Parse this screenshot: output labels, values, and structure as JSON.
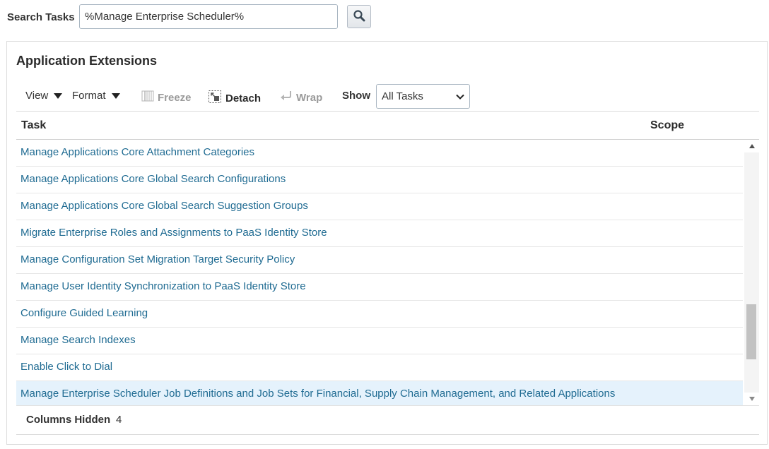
{
  "search": {
    "label": "Search Tasks",
    "value": "%Manage Enterprise Scheduler%",
    "button_icon": "search-icon"
  },
  "panel": {
    "title": "Application Extensions"
  },
  "toolbar": {
    "view_label": "View",
    "format_label": "Format",
    "freeze_label": "Freeze",
    "detach_label": "Detach",
    "wrap_label": "Wrap",
    "show_label": "Show",
    "show_selected": "All Tasks"
  },
  "table": {
    "columns": [
      "Task",
      "Scope"
    ],
    "rows": [
      "Manage Applications Core Attachment Categories",
      "Manage Applications Core Global Search Configurations",
      "Manage Applications Core Global Search Suggestion Groups",
      "Migrate Enterprise Roles and Assignments to PaaS Identity Store",
      "Manage Configuration Set Migration Target Security Policy",
      "Manage User Identity Synchronization to PaaS Identity Store",
      "Configure Guided Learning",
      "Manage Search Indexes",
      "Enable Click to Dial",
      "Manage Enterprise Scheduler Job Definitions and Job Sets for Financial, Supply Chain Management, and Related Applications"
    ],
    "selected_row": 9,
    "scroll_position": 0.82,
    "scroll_thumb_fraction": 0.23
  },
  "footer": {
    "columns_hidden_label": "Columns Hidden",
    "columns_hidden_count": "4"
  },
  "colors": {
    "link": "#1f6b92",
    "selected_row": "#e5f2fc"
  }
}
